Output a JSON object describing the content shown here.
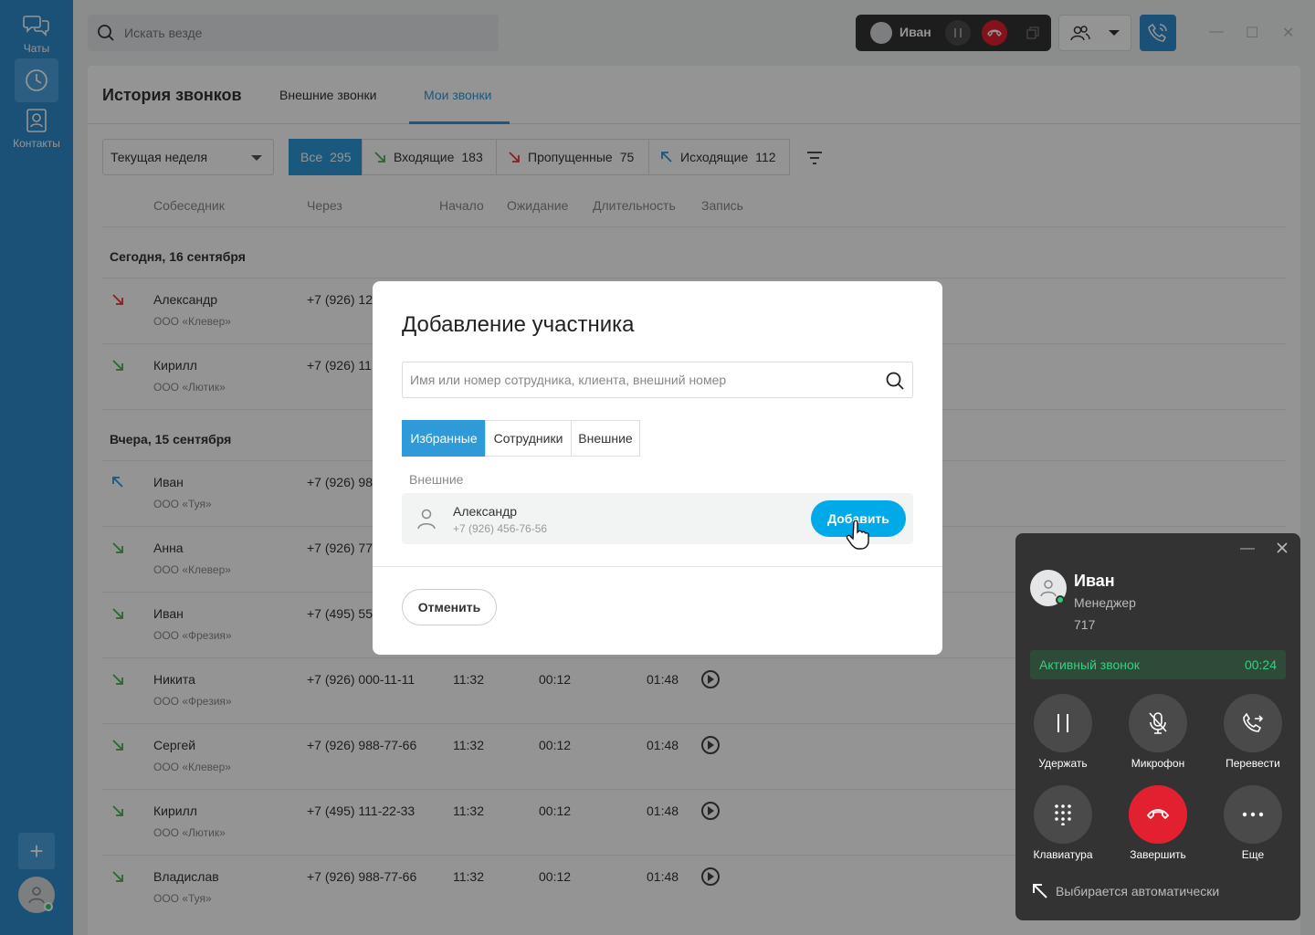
{
  "sidebar": {
    "items": [
      {
        "label": "Чаты",
        "icon": "chat-icon"
      },
      {
        "label": "",
        "icon": "clock-icon"
      },
      {
        "label": "Контакты",
        "icon": "contacts-icon"
      }
    ],
    "add_label": "+"
  },
  "topbar": {
    "search_placeholder": "Искать везде",
    "call_pill_name": "Иван"
  },
  "main": {
    "title": "История звонков",
    "tabs": [
      "Внешние звонки",
      "Мои звонки"
    ],
    "period": "Текущая неделя",
    "filters": [
      {
        "label": "Все",
        "count": "295"
      },
      {
        "label": "Входящие",
        "count": "183"
      },
      {
        "label": "Пропущенные",
        "count": "75"
      },
      {
        "label": "Исходящие",
        "count": "112"
      }
    ],
    "columns": [
      "Собеседник",
      "Через",
      "Начало",
      "Ожидание",
      "Длительность",
      "Запись"
    ],
    "groups": [
      {
        "day": "Сегодня, 16 сентября",
        "rows": [
          {
            "name": "Александр",
            "org": "ООО «Клевер»",
            "phone": "+7 (926) 12",
            "start": "",
            "wait": "",
            "dur": "",
            "type": "missed"
          },
          {
            "name": "Кирилл",
            "org": "ООО «Лютик»",
            "phone": "+7 (926) 11",
            "start": "",
            "wait": "",
            "dur": "",
            "type": "incoming"
          }
        ]
      },
      {
        "day": "Вчера, 15 сентября",
        "rows": [
          {
            "name": "Иван",
            "org": "ООО «Туя»",
            "phone": "+7 (926) 98",
            "start": "",
            "wait": "",
            "dur": "",
            "type": "outgoing"
          },
          {
            "name": "Анна",
            "org": "ООО «Клевер»",
            "phone": "+7 (926) 77",
            "start": "",
            "wait": "",
            "dur": "",
            "type": "incoming"
          },
          {
            "name": "Иван",
            "org": "ООО «Фрезия»",
            "phone": "+7 (495) 55",
            "start": "",
            "wait": "",
            "dur": "",
            "type": "incoming"
          },
          {
            "name": "Никита",
            "org": "ООО «Фрезия»",
            "phone": "+7 (926) 000-11-11",
            "start": "11:32",
            "wait": "00:12",
            "dur": "01:48",
            "type": "incoming"
          },
          {
            "name": "Сергей",
            "org": "ООО «Клевер»",
            "phone": "+7 (926) 988-77-66",
            "start": "11:32",
            "wait": "00:12",
            "dur": "01:48",
            "type": "incoming"
          },
          {
            "name": "Кирилл",
            "org": "ООО «Лютик»",
            "phone": "+7 (495) 111-22-33",
            "start": "11:32",
            "wait": "00:12",
            "dur": "01:48",
            "type": "incoming"
          },
          {
            "name": "Владислав",
            "org": "ООО «Туя»",
            "phone": "+7 (926) 988-77-66",
            "start": "11:32",
            "wait": "00:12",
            "dur": "01:48",
            "type": "incoming"
          }
        ]
      }
    ]
  },
  "modal": {
    "title": "Добавление участника",
    "search_placeholder": "Имя или номер сотрудника, клиента, внешний номер",
    "tabs": [
      "Избранные",
      "Сотрудники",
      "Внешние"
    ],
    "section": "Внешние",
    "contact": {
      "name": "Александр",
      "phone": "+7 (926) 456-76-56"
    },
    "add_label": "Добавить",
    "cancel_label": "Отменить"
  },
  "widget": {
    "name": "Иван",
    "role": "Менеджер",
    "ext": "717",
    "status": "Активный звонок",
    "timer": "00:24",
    "buttons": [
      "Удержать",
      "Микрофон",
      "Перевести",
      "Клавиатура",
      "Завершить",
      "Еще"
    ],
    "footer": "Выбирается автоматически"
  },
  "colors": {
    "accent": "#2e9ad7",
    "sidebar": "#2f8ccc",
    "hangup": "#e3202f",
    "incoming": "#4caf50",
    "missed": "#e53935",
    "outgoing": "#2e9ad7"
  }
}
